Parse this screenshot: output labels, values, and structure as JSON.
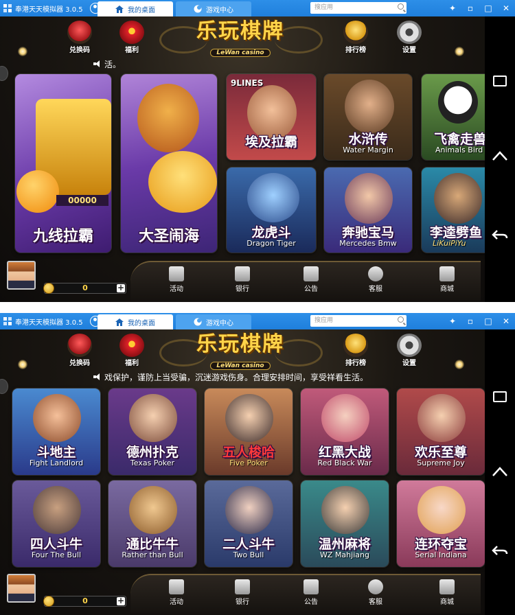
{
  "emulator": {
    "app_name": "奉港天天模拟器 3.0.5",
    "tabs": [
      {
        "label": "我的桌面",
        "icon": "home-icon"
      },
      {
        "label": "游戏中心",
        "icon": "game-center-icon"
      }
    ],
    "search_placeholder": "搜应用",
    "window_buttons": [
      "pin",
      "minimize",
      "maximize",
      "close"
    ]
  },
  "android_nav": [
    "recent-apps",
    "home",
    "back"
  ],
  "game": {
    "logo_cn": "乐玩棋牌",
    "logo_en": "LeWan casino",
    "top_menu": [
      {
        "label": "兑换码",
        "icon": "gift-icon"
      },
      {
        "label": "福利",
        "icon": "red-envelope-icon"
      },
      {
        "label": "排行榜",
        "icon": "trophy-icon"
      },
      {
        "label": "设置",
        "icon": "gear-icon"
      }
    ],
    "bottom_menu": [
      {
        "label": "活动",
        "icon": "gift-box-icon"
      },
      {
        "label": "银行",
        "icon": "bank-icon"
      },
      {
        "label": "公告",
        "icon": "notice-icon"
      },
      {
        "label": "客服",
        "icon": "support-icon"
      },
      {
        "label": "商城",
        "icon": "cart-icon"
      }
    ],
    "coins": "0"
  },
  "screen1": {
    "marquee": "活。",
    "cards": [
      {
        "title": "九线拉霸",
        "sub": "",
        "banner": "00000"
      },
      {
        "title": "大圣闹海",
        "sub": ""
      },
      {
        "title": "埃及拉霸",
        "sub": "",
        "badge": "9LINES"
      },
      {
        "title": "水浒传",
        "sub": "Water Margin"
      },
      {
        "title": "飞禽走兽",
        "sub": "Animals Bird"
      },
      {
        "title": "龙虎斗",
        "sub": "Dragon Tiger"
      },
      {
        "title": "奔驰宝马",
        "sub": "Mercedes Bmw"
      },
      {
        "title": "李逵劈鱼",
        "sub": "LiKuiPiYu"
      }
    ]
  },
  "screen2": {
    "marquee": "戏保护，谨防上当受骗，沉迷游戏伤身。合理安排时间，享受祥看生活。",
    "cards": [
      {
        "title": "斗地主",
        "sub": "Fight Landlord"
      },
      {
        "title": "德州扑克",
        "sub": "Texas Poker"
      },
      {
        "title": "五人梭哈",
        "sub": "Five Poker"
      },
      {
        "title": "红黑大战",
        "sub": "Red Black War"
      },
      {
        "title": "欢乐至尊",
        "sub": "Supreme Joy"
      },
      {
        "title": "四人斗牛",
        "sub": "Four The Bull"
      },
      {
        "title": "通比牛牛",
        "sub": "Rather than Bull"
      },
      {
        "title": "二人斗牛",
        "sub": "Two Bull"
      },
      {
        "title": "温州麻将",
        "sub": "WZ Mahjiang"
      },
      {
        "title": "连环夺宝",
        "sub": "Serial Indiana"
      }
    ]
  },
  "colors": {
    "titlebar": "#1f7fdc",
    "gold": "#ffd54a"
  }
}
